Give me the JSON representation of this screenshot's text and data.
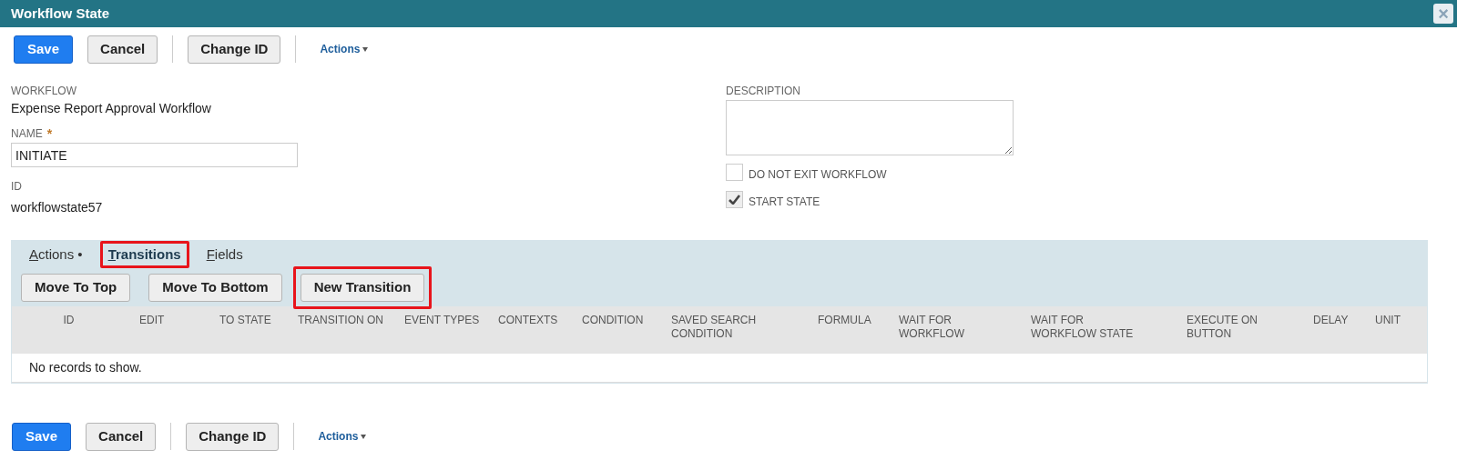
{
  "window": {
    "title": "Workflow State",
    "close_label": "×"
  },
  "top_toolbar": {
    "buttons": [
      {
        "label": "Save",
        "kind": "primary"
      },
      {
        "label": "Cancel",
        "kind": "secondary"
      },
      {
        "kind": "divider"
      },
      {
        "label": "Change ID",
        "kind": "secondary"
      },
      {
        "kind": "divider"
      }
    ],
    "actions": "Actions"
  },
  "form": {
    "workflow": {
      "label": "WORKFLOW",
      "value": "Expense Report Approval Workflow"
    },
    "name": {
      "label": "NAME",
      "required_mark": "*",
      "value": "INITIATE"
    },
    "id": {
      "label": "ID",
      "value": "workflowstate57"
    },
    "description": {
      "label": "DESCRIPTION"
    },
    "checkboxes": [
      {
        "label": "DO NOT EXIT WORKFLOW",
        "checked": false
      },
      {
        "label": "START STATE",
        "checked": true
      }
    ]
  },
  "subtabs": [
    {
      "label": "Actions •",
      "selected": false,
      "highlighted": false
    },
    {
      "label": "Transitions",
      "selected": true,
      "highlighted": true
    },
    {
      "label": "Fields",
      "selected": false,
      "highlighted": false
    }
  ],
  "sublist_buttons": [
    {
      "label": "Move To Top",
      "highlighted": false
    },
    {
      "label": "Move To Bottom",
      "highlighted": false
    },
    {
      "label": "New Transition",
      "highlighted": true
    }
  ],
  "table": {
    "columns": [
      "ID",
      "EDIT",
      "TO STATE",
      "TRANSITION ON",
      "EVENT TYPES",
      "CONTEXTS",
      "CONDITION",
      "SAVED SEARCH CONDITION",
      "FORMULA",
      "WAIT FOR WORKFLOW",
      "WAIT FOR WORKFLOW STATE",
      "EXECUTE ON BUTTON",
      "DELAY",
      "UNIT"
    ],
    "empty_message": "No records to show."
  },
  "bottom_toolbar": {
    "buttons": [
      {
        "label": "Save",
        "kind": "primary"
      },
      {
        "label": "Cancel",
        "kind": "secondary"
      },
      {
        "kind": "divider"
      },
      {
        "label": "Change ID",
        "kind": "secondary"
      },
      {
        "kind": "divider"
      }
    ],
    "actions": "Actions"
  }
}
